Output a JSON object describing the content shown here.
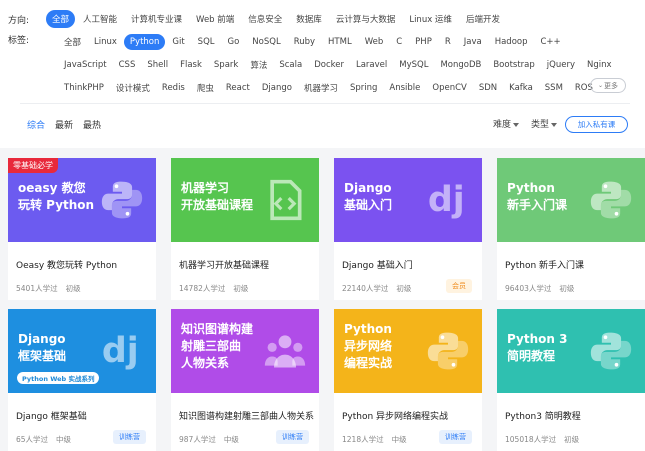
{
  "direction": {
    "label": "方向:",
    "items": [
      "全部",
      "人工智能",
      "计算机专业课",
      "Web 前端",
      "信息安全",
      "数据库",
      "云计算与大数据",
      "Linux 运维",
      "后端开发"
    ]
  },
  "tags": {
    "label": "标签:",
    "rows": [
      [
        "全部",
        "Linux",
        "Python",
        "Git",
        "SQL",
        "Go",
        "NoSQL",
        "Ruby",
        "HTML",
        "Web",
        "C",
        "PHP",
        "R",
        "Java",
        "Hadoop",
        "C++"
      ],
      [
        "JavaScript",
        "CSS",
        "Shell",
        "Flask",
        "Spark",
        "算法",
        "Scala",
        "Docker",
        "Laravel",
        "MySQL",
        "MongoDB",
        "Bootstrap",
        "jQuery",
        "Nginx"
      ],
      [
        "ThinkPHP",
        "设计模式",
        "Redis",
        "爬虫",
        "React",
        "Django",
        "机器学习",
        "Spring",
        "Ansible",
        "OpenCV",
        "SDN",
        "Kafka",
        "SSM",
        "ROS"
      ]
    ],
    "more": "更多"
  },
  "sort": {
    "items": [
      "综合",
      "最新",
      "最热"
    ]
  },
  "filters": {
    "difficulty": "难度",
    "type": "类型",
    "join": "加入私有课"
  },
  "colors": {
    "accent": "#2d7cf6"
  },
  "courses": [
    {
      "thumb": "oeasy 教您\n玩转 Python",
      "corner": "零基础必学",
      "icon": "python-icon",
      "bg": "#6c5bf0",
      "title": "Oeasy 教您玩转 Python",
      "learners": "5401人学过",
      "level": "初级",
      "badge": ""
    },
    {
      "thumb": "机器学习\n开放基础课程",
      "icon": "code-file-icon",
      "bg": "#56c54f",
      "title": "机器学习开放基础课程",
      "learners": "14782人学过",
      "level": "初级",
      "badge": ""
    },
    {
      "thumb": "Django\n基础入门",
      "icon": "django-icon",
      "bg": "#7b52f0",
      "title": "Django 基础入门",
      "learners": "22140人学过",
      "level": "初级",
      "badge": "会员"
    },
    {
      "thumb": "Python\n新手入门课",
      "icon": "python-icon",
      "bg": "#6fc978",
      "title": "Python 新手入门课",
      "learners": "96403人学过",
      "level": "初级",
      "badge": ""
    },
    {
      "thumb": "Django\n框架基础",
      "sub": "Python Web 实战系列",
      "icon": "django-icon",
      "bg": "#1e8fe0",
      "title": "Django 框架基础",
      "learners": "65人学过",
      "level": "中级",
      "badge": "训练营"
    },
    {
      "thumb": "知识图谱构建\n射雕三部曲\n人物关系",
      "icon": "people-icon",
      "bg": "#b04ce8",
      "title": "知识图谱构建射雕三部曲人物关系",
      "learners": "987人学过",
      "level": "中级",
      "badge": "训练营"
    },
    {
      "thumb": "Python\n异步网络\n编程实战",
      "icon": "python-icon",
      "bg": "#f4b41a",
      "title": "Python 异步网络编程实战",
      "learners": "1218人学过",
      "level": "中级",
      "badge": "训练营"
    },
    {
      "thumb": "Python 3\n简明教程",
      "icon": "python-icon",
      "bg": "#2fc0b0",
      "title": "Python3 简明教程",
      "learners": "105018人学过",
      "level": "初级",
      "badge": ""
    }
  ]
}
